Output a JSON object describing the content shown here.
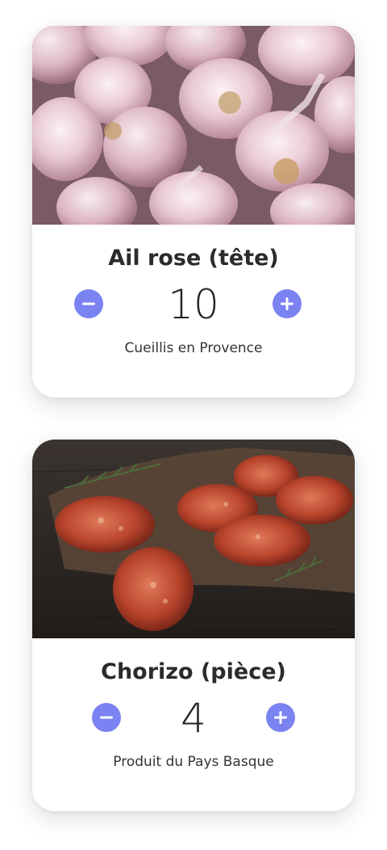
{
  "products": [
    {
      "title": "Ail rose (tête)",
      "quantity": "10",
      "subtitle": "Cueillis en Provence",
      "image": "garlic-photo"
    },
    {
      "title": "Chorizo (pièce)",
      "quantity": "4",
      "subtitle": "Produit du Pays Basque",
      "image": "chorizo-photo"
    }
  ],
  "controls": {
    "decrement_icon": "minus-icon",
    "increment_icon": "plus-icon",
    "accent_color": "#7b83f2"
  }
}
